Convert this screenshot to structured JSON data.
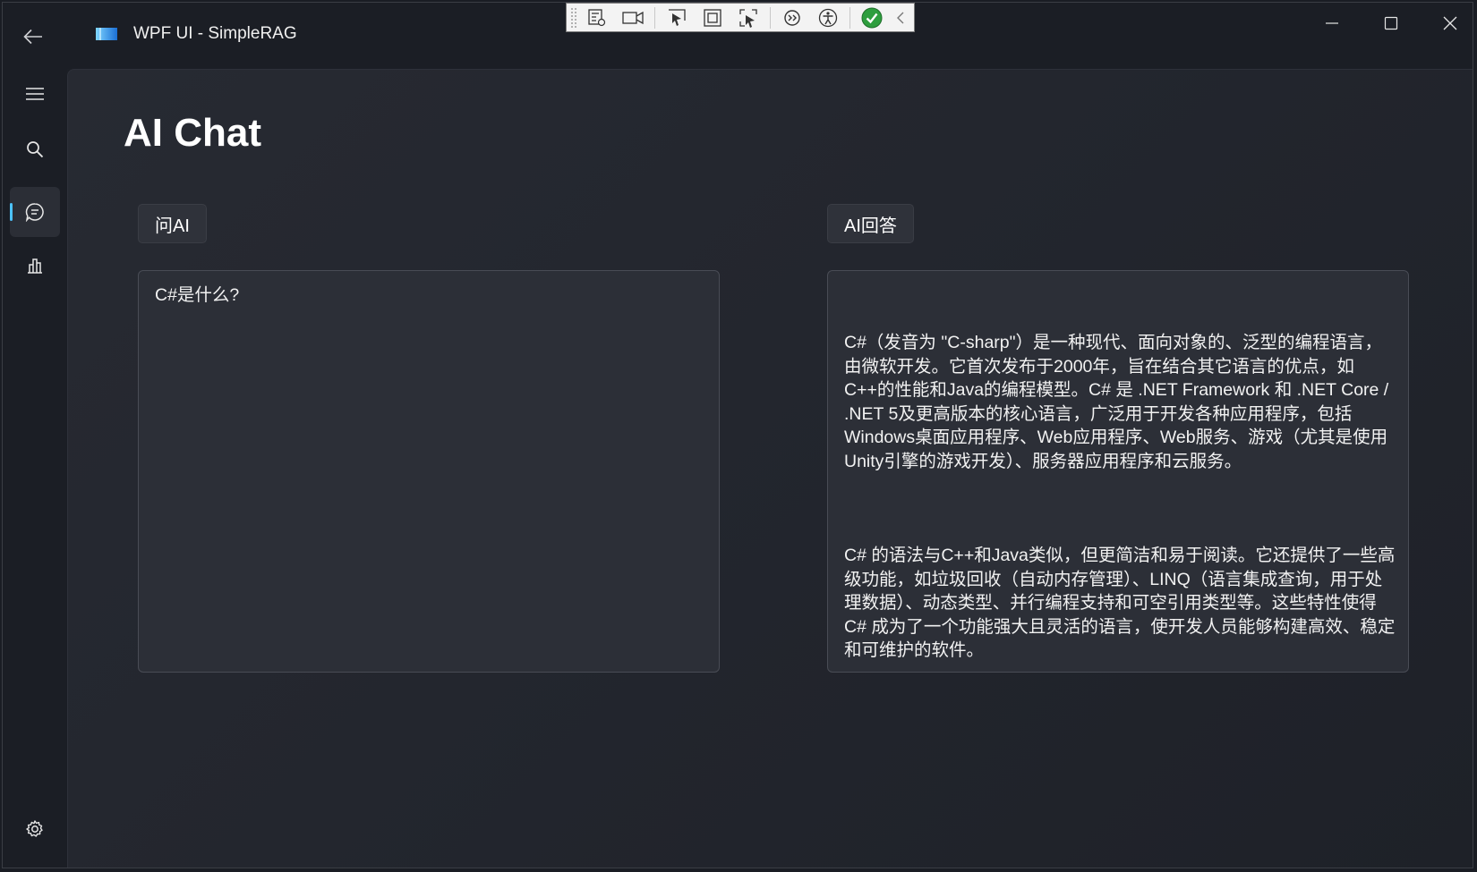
{
  "window": {
    "title": "WPF UI - SimpleRAG"
  },
  "page": {
    "title": "AI Chat"
  },
  "ask": {
    "label": "问AI",
    "question": "C#是什么?"
  },
  "answer": {
    "label": "AI回答",
    "paragraphs": [
      "C#（发音为 \"C-sharp\"）是一种现代、面向对象的、泛型的编程语言，由微软开发。它首次发布于2000年，旨在结合其它语言的优点，如C++的性能和Java的编程模型。C# 是 .NET Framework 和 .NET Core / .NET 5及更高版本的核心语言，广泛用于开发各种应用程序，包括Windows桌面应用程序、Web应用程序、Web服务、游戏（尤其是使用Unity引擎的游戏开发）、服务器应用程序和云服务。",
      "C# 的语法与C++和Java类似，但更简洁和易于阅读。它还提供了一些高级功能，如垃圾回收（自动内存管理）、LINQ（语言集成查询，用于处理数据）、动态类型、并行编程支持和可空引用类型等。这些特性使得C# 成为了一个功能强大且灵活的语言，使开发人员能够构建高效、稳定和可维护的软件。"
    ]
  },
  "icons": {
    "back": "arrow-left-icon",
    "menu": "hamburger-icon",
    "search": "search-icon",
    "chat": "chat-icon",
    "chart": "bar-chart-icon",
    "settings": "gear-icon"
  },
  "colors": {
    "accent": "#4cc2ff",
    "background": "#1c1f26"
  }
}
